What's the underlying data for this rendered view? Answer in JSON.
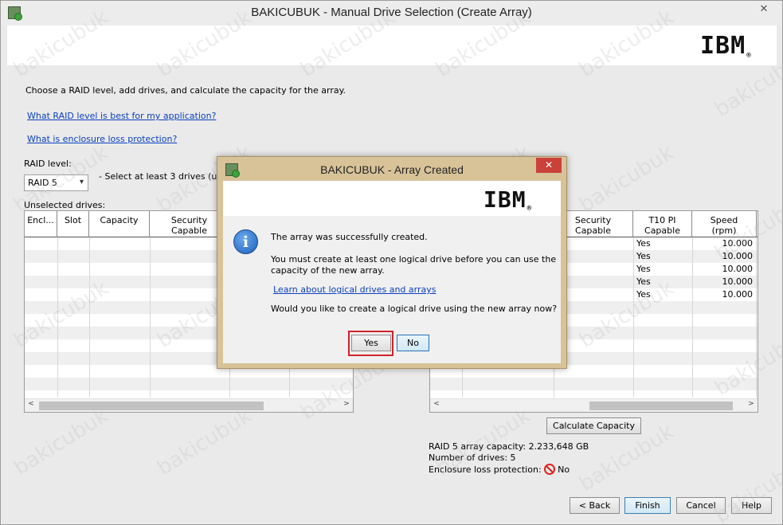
{
  "window": {
    "title": "BAKICUBUK - Manual Drive Selection (Create Array)",
    "close_glyph": "✕",
    "icon": "app-drive-icon",
    "logo": "IBM",
    "logo_mark": "®"
  },
  "instructions": "Choose a RAID level, add drives, and calculate the capacity for the array.",
  "links": {
    "raid_help": "What RAID level is best for my application?",
    "enclosure_help": "What is enclosure loss protection?"
  },
  "raid": {
    "label": "RAID level:",
    "selected": "RAID 5",
    "hint": "- Select at least 3 drives (up to"
  },
  "unselected": {
    "label": "Unselected drives:",
    "columns": [
      "Encl...",
      "Slot",
      "Capacity",
      "Security\nCapable"
    ]
  },
  "selected": {
    "columns": [
      "Security\nCapable",
      "T10 PI\nCapable",
      "Speed\n(rpm)"
    ],
    "rows": [
      {
        "t10": "Yes",
        "speed": "10.000"
      },
      {
        "t10": "Yes",
        "speed": "10.000"
      },
      {
        "t10": "Yes",
        "speed": "10.000"
      },
      {
        "t10": "Yes",
        "speed": "10.000"
      },
      {
        "t10": "Yes",
        "speed": "10.000"
      }
    ]
  },
  "calculate_button": "Calculate Capacity",
  "summary": {
    "capacity": "RAID 5 array capacity: 2.233,648 GB",
    "drives": "Number of drives: 5",
    "enclosure_label": "Enclosure loss protection:",
    "enclosure_value": "No"
  },
  "footer": {
    "back": "< Back",
    "finish": "Finish",
    "cancel": "Cancel",
    "help": "Help"
  },
  "dialog": {
    "title": "BAKICUBUK - Array Created",
    "close_glyph": "✕",
    "logo": "IBM",
    "logo_mark": "®",
    "icon_glyph": "i",
    "line1": "The array was successfully created.",
    "line2a": "You must create at least one logical drive before you can use the",
    "line2b": "capacity of the new array.",
    "link": "Learn about logical drives and arrays",
    "question": "Would you like to create a logical drive using the new array now?",
    "yes": "Yes",
    "no": "No"
  },
  "scroll": {
    "left": "<",
    "right": ">"
  },
  "watermark": "bakicubuk"
}
